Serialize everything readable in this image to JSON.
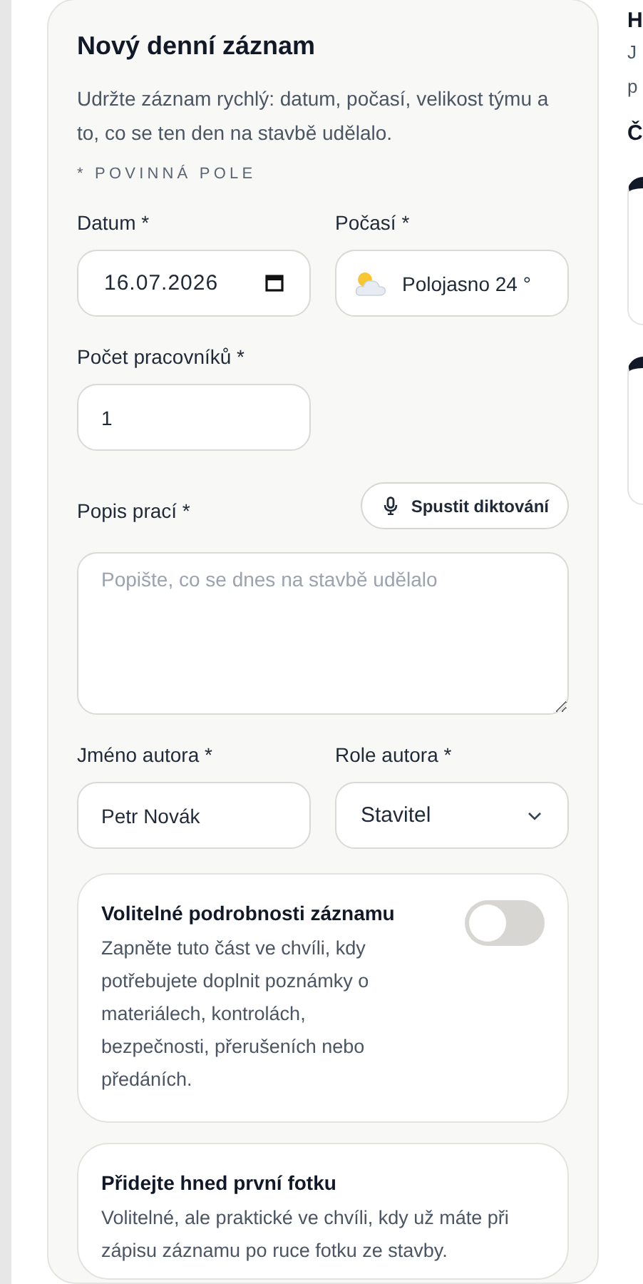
{
  "form": {
    "title": "Nový denní záznam",
    "intro": "Udržte záznam rychlý: datum, počasí, velikost týmu a to, co se ten den na stavbě udělalo.",
    "required_note": "* POVINNÁ POLE",
    "date": {
      "label": "Datum *",
      "value": "16.07.2026"
    },
    "weather": {
      "label": "Počasí *",
      "value": "Polojasno 24 °"
    },
    "workers": {
      "label": "Počet pracovníků *",
      "value": "1"
    },
    "description": {
      "label": "Popis prací *",
      "placeholder": "Popište, co se dnes na stavbě udělalo",
      "dictate_button": "Spustit diktování"
    },
    "author_name": {
      "label": "Jméno autora *",
      "value": "Petr Novák"
    },
    "author_role": {
      "label": "Role autora *",
      "value": "Stavitel"
    },
    "optional_details": {
      "title": "Volitelné podrobnosti záznamu",
      "text": "Zapněte tuto část ve chvíli, kdy potřebujete doplnit poznámky o materiálech, kontrolách, bezpečnosti, přerušeních nebo předáních.",
      "on": false
    },
    "photo": {
      "title": "Přidejte hned první fotku",
      "text": "Volitelné, ale praktické ve chvíli, kdy už máte při zápisu záznamu po ruce fotku ze stavby."
    }
  },
  "side": {
    "heading": "H",
    "lines": [
      "J",
      "p"
    ],
    "subheading": "Č"
  }
}
